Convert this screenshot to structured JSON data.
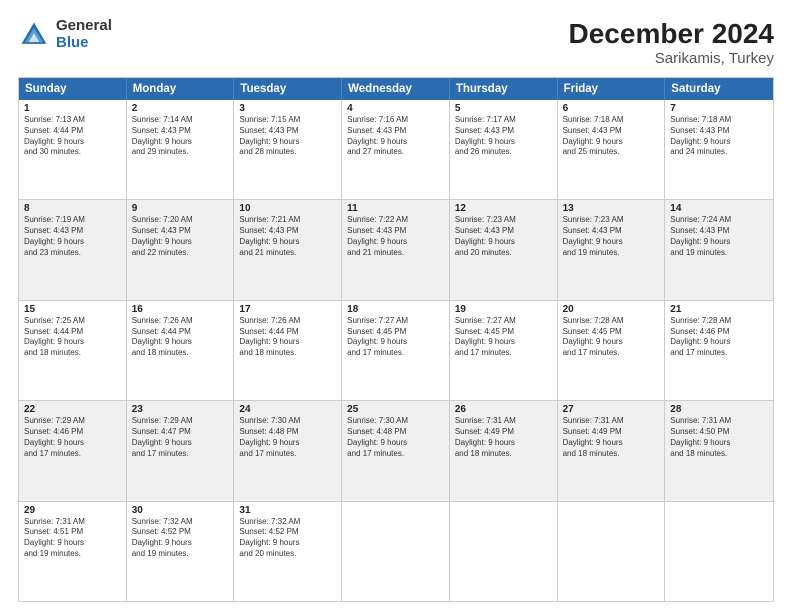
{
  "logo": {
    "general": "General",
    "blue": "Blue"
  },
  "title": "December 2024",
  "subtitle": "Sarikamis, Turkey",
  "header_days": [
    "Sunday",
    "Monday",
    "Tuesday",
    "Wednesday",
    "Thursday",
    "Friday",
    "Saturday"
  ],
  "rows": [
    {
      "shaded": false,
      "cells": [
        {
          "day": "1",
          "lines": [
            "Sunrise: 7:13 AM",
            "Sunset: 4:44 PM",
            "Daylight: 9 hours",
            "and 30 minutes."
          ]
        },
        {
          "day": "2",
          "lines": [
            "Sunrise: 7:14 AM",
            "Sunset: 4:43 PM",
            "Daylight: 9 hours",
            "and 29 minutes."
          ]
        },
        {
          "day": "3",
          "lines": [
            "Sunrise: 7:15 AM",
            "Sunset: 4:43 PM",
            "Daylight: 9 hours",
            "and 28 minutes."
          ]
        },
        {
          "day": "4",
          "lines": [
            "Sunrise: 7:16 AM",
            "Sunset: 4:43 PM",
            "Daylight: 9 hours",
            "and 27 minutes."
          ]
        },
        {
          "day": "5",
          "lines": [
            "Sunrise: 7:17 AM",
            "Sunset: 4:43 PM",
            "Daylight: 9 hours",
            "and 26 minutes."
          ]
        },
        {
          "day": "6",
          "lines": [
            "Sunrise: 7:18 AM",
            "Sunset: 4:43 PM",
            "Daylight: 9 hours",
            "and 25 minutes."
          ]
        },
        {
          "day": "7",
          "lines": [
            "Sunrise: 7:18 AM",
            "Sunset: 4:43 PM",
            "Daylight: 9 hours",
            "and 24 minutes."
          ]
        }
      ]
    },
    {
      "shaded": true,
      "cells": [
        {
          "day": "8",
          "lines": [
            "Sunrise: 7:19 AM",
            "Sunset: 4:43 PM",
            "Daylight: 9 hours",
            "and 23 minutes."
          ]
        },
        {
          "day": "9",
          "lines": [
            "Sunrise: 7:20 AM",
            "Sunset: 4:43 PM",
            "Daylight: 9 hours",
            "and 22 minutes."
          ]
        },
        {
          "day": "10",
          "lines": [
            "Sunrise: 7:21 AM",
            "Sunset: 4:43 PM",
            "Daylight: 9 hours",
            "and 21 minutes."
          ]
        },
        {
          "day": "11",
          "lines": [
            "Sunrise: 7:22 AM",
            "Sunset: 4:43 PM",
            "Daylight: 9 hours",
            "and 21 minutes."
          ]
        },
        {
          "day": "12",
          "lines": [
            "Sunrise: 7:23 AM",
            "Sunset: 4:43 PM",
            "Daylight: 9 hours",
            "and 20 minutes."
          ]
        },
        {
          "day": "13",
          "lines": [
            "Sunrise: 7:23 AM",
            "Sunset: 4:43 PM",
            "Daylight: 9 hours",
            "and 19 minutes."
          ]
        },
        {
          "day": "14",
          "lines": [
            "Sunrise: 7:24 AM",
            "Sunset: 4:43 PM",
            "Daylight: 9 hours",
            "and 19 minutes."
          ]
        }
      ]
    },
    {
      "shaded": false,
      "cells": [
        {
          "day": "15",
          "lines": [
            "Sunrise: 7:25 AM",
            "Sunset: 4:44 PM",
            "Daylight: 9 hours",
            "and 18 minutes."
          ]
        },
        {
          "day": "16",
          "lines": [
            "Sunrise: 7:26 AM",
            "Sunset: 4:44 PM",
            "Daylight: 9 hours",
            "and 18 minutes."
          ]
        },
        {
          "day": "17",
          "lines": [
            "Sunrise: 7:26 AM",
            "Sunset: 4:44 PM",
            "Daylight: 9 hours",
            "and 18 minutes."
          ]
        },
        {
          "day": "18",
          "lines": [
            "Sunrise: 7:27 AM",
            "Sunset: 4:45 PM",
            "Daylight: 9 hours",
            "and 17 minutes."
          ]
        },
        {
          "day": "19",
          "lines": [
            "Sunrise: 7:27 AM",
            "Sunset: 4:45 PM",
            "Daylight: 9 hours",
            "and 17 minutes."
          ]
        },
        {
          "day": "20",
          "lines": [
            "Sunrise: 7:28 AM",
            "Sunset: 4:45 PM",
            "Daylight: 9 hours",
            "and 17 minutes."
          ]
        },
        {
          "day": "21",
          "lines": [
            "Sunrise: 7:28 AM",
            "Sunset: 4:46 PM",
            "Daylight: 9 hours",
            "and 17 minutes."
          ]
        }
      ]
    },
    {
      "shaded": true,
      "cells": [
        {
          "day": "22",
          "lines": [
            "Sunrise: 7:29 AM",
            "Sunset: 4:46 PM",
            "Daylight: 9 hours",
            "and 17 minutes."
          ]
        },
        {
          "day": "23",
          "lines": [
            "Sunrise: 7:29 AM",
            "Sunset: 4:47 PM",
            "Daylight: 9 hours",
            "and 17 minutes."
          ]
        },
        {
          "day": "24",
          "lines": [
            "Sunrise: 7:30 AM",
            "Sunset: 4:48 PM",
            "Daylight: 9 hours",
            "and 17 minutes."
          ]
        },
        {
          "day": "25",
          "lines": [
            "Sunrise: 7:30 AM",
            "Sunset: 4:48 PM",
            "Daylight: 9 hours",
            "and 17 minutes."
          ]
        },
        {
          "day": "26",
          "lines": [
            "Sunrise: 7:31 AM",
            "Sunset: 4:49 PM",
            "Daylight: 9 hours",
            "and 18 minutes."
          ]
        },
        {
          "day": "27",
          "lines": [
            "Sunrise: 7:31 AM",
            "Sunset: 4:49 PM",
            "Daylight: 9 hours",
            "and 18 minutes."
          ]
        },
        {
          "day": "28",
          "lines": [
            "Sunrise: 7:31 AM",
            "Sunset: 4:50 PM",
            "Daylight: 9 hours",
            "and 18 minutes."
          ]
        }
      ]
    },
    {
      "shaded": false,
      "cells": [
        {
          "day": "29",
          "lines": [
            "Sunrise: 7:31 AM",
            "Sunset: 4:51 PM",
            "Daylight: 9 hours",
            "and 19 minutes."
          ]
        },
        {
          "day": "30",
          "lines": [
            "Sunrise: 7:32 AM",
            "Sunset: 4:52 PM",
            "Daylight: 9 hours",
            "and 19 minutes."
          ]
        },
        {
          "day": "31",
          "lines": [
            "Sunrise: 7:32 AM",
            "Sunset: 4:52 PM",
            "Daylight: 9 hours",
            "and 20 minutes."
          ]
        },
        {
          "day": "",
          "lines": []
        },
        {
          "day": "",
          "lines": []
        },
        {
          "day": "",
          "lines": []
        },
        {
          "day": "",
          "lines": []
        }
      ]
    }
  ]
}
